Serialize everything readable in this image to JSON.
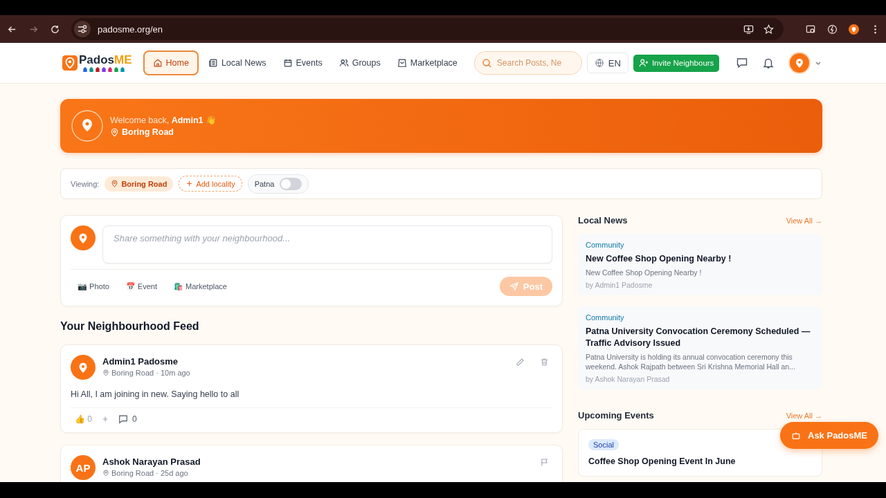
{
  "browser": {
    "url": "padosme.org/en"
  },
  "header": {
    "logo": {
      "main": "Pados",
      "accent": "ME"
    },
    "nav": [
      {
        "label": "Home",
        "selected": true
      },
      {
        "label": "Local News",
        "selected": false
      },
      {
        "label": "Events",
        "selected": false
      },
      {
        "label": "Groups",
        "selected": false
      },
      {
        "label": "Marketplace",
        "selected": false
      }
    ],
    "search": {
      "placeholder": "Search Posts, Ne"
    },
    "language": "EN",
    "invite": "Invite Neighbours"
  },
  "welcome": {
    "greeting": "Welcome back, **Admin1** 👋",
    "location": "Boring Road"
  },
  "filter": {
    "label": "Viewing:",
    "chip": "Boring Road",
    "add": "Add locality",
    "toggle": {
      "label": "Patna",
      "on": false
    }
  },
  "composer": {
    "placeholder": "Share something with your neighbourhood...",
    "actions": [
      "📷 Photo",
      "📅 Event",
      "🛍️ Marketplace"
    ],
    "post": {
      "label": "Post",
      "disabled": true
    }
  },
  "feed": {
    "title": "Your Neighbourhood Feed",
    "posts": [
      {
        "author": "Admin1 Padosme",
        "meta": "Boring Road · 10m ago",
        "body": "Hi All, I am joining in new. Saying hello to all",
        "reaction": "👍",
        "likes": "0",
        "comments": "0",
        "own": true
      },
      {
        "author": "Ashok Narayan Prasad",
        "initials": "AP",
        "meta": "Boring Road · 25d ago",
        "own": false
      }
    ]
  },
  "news": {
    "title": "Local News",
    "view_all": "View All →",
    "items": [
      {
        "tag": "Community",
        "title": "New Coffee Shop Opening Nearby !",
        "summary": "New Coffee Shop Opening Nearby !",
        "byline": "by Admin1 Padosme"
      },
      {
        "tag": "Community",
        "title": "Patna University Convocation Ceremony Scheduled — Traffic Advisory Issued",
        "summary": "Patna University is holding its annual convocation ceremony this weekend. Ashok Rajpath between Sri Krishna Memorial Hall an...",
        "byline": "by Ashok Narayan Prasad"
      }
    ]
  },
  "events": {
    "title": "Upcoming Events",
    "view_all": "View All →",
    "items": [
      {
        "tag": "Social",
        "title": "Coffee Shop Opening Event In June"
      }
    ]
  },
  "assistant": {
    "label": "Ask PadosME"
  }
}
